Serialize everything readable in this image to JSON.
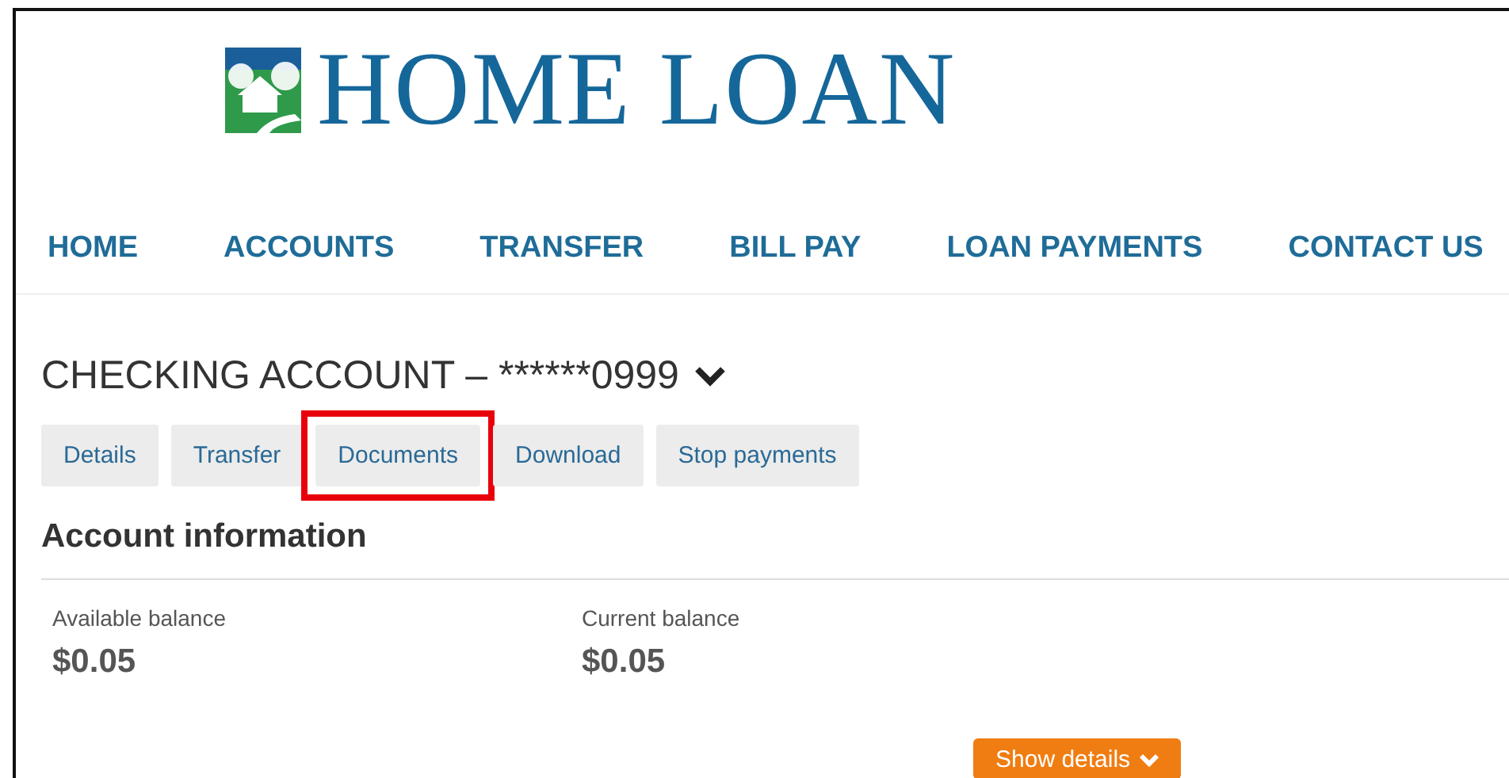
{
  "logo": {
    "text": "HOME LOAN"
  },
  "nav": [
    {
      "label": "HOME"
    },
    {
      "label": "ACCOUNTS"
    },
    {
      "label": "TRANSFER"
    },
    {
      "label": "BILL PAY"
    },
    {
      "label": "LOAN PAYMENTS"
    },
    {
      "label": "CONTACT US"
    }
  ],
  "account": {
    "title": "CHECKING ACCOUNT – ******0999",
    "expanded": false
  },
  "actions": [
    {
      "label": "Details",
      "highlighted": false
    },
    {
      "label": "Transfer",
      "highlighted": false
    },
    {
      "label": "Documents",
      "highlighted": true
    },
    {
      "label": "Download",
      "highlighted": false
    },
    {
      "label": "Stop payments",
      "highlighted": false
    }
  ],
  "section": {
    "title": "Account information"
  },
  "balances": [
    {
      "label": "Available balance",
      "value": "$0.05"
    },
    {
      "label": "Current balance",
      "value": "$0.05"
    }
  ],
  "show_details_button": {
    "label": "Show details"
  }
}
